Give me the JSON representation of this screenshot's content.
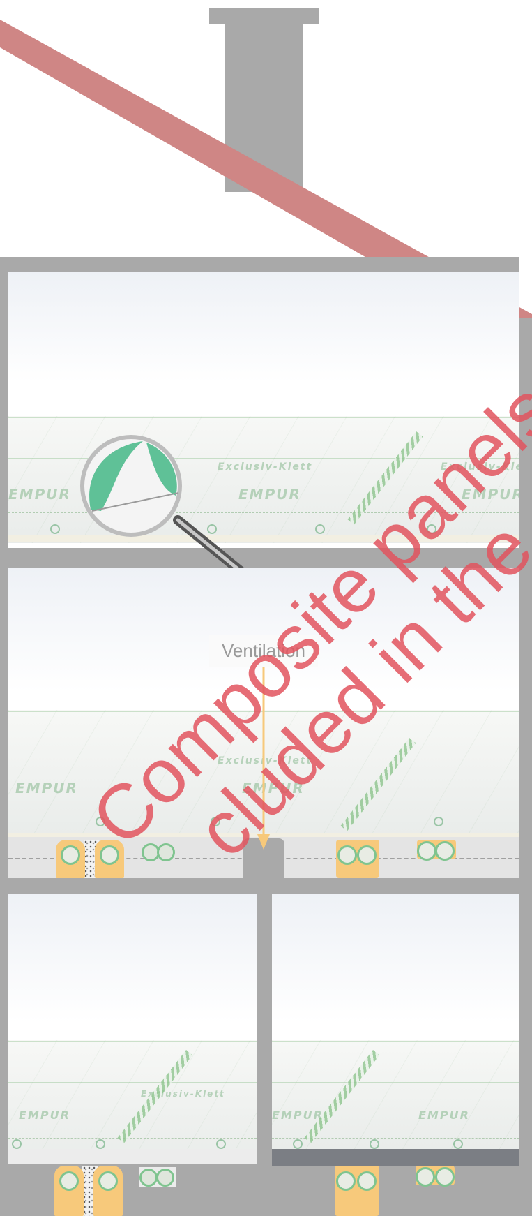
{
  "labels": {
    "ventilation": "Ventilation",
    "brand_text": "EMPUR",
    "panel_text": "Exclusiv-Klett",
    "watermark_line1": "Composite panels",
    "watermark_line2": "cluded in the"
  },
  "colors": {
    "roof": "#cf8685",
    "walls": "#a9a9a9",
    "pipe": "#f7c97b",
    "pipe_ring": "#7fc48f",
    "ventilation_arrow": "#f7c97b",
    "watermark": "#e2545e",
    "panel_accent": "#8dc48d"
  },
  "icons": {
    "magnifier": "magnifier-icon",
    "arrow": "arrow-down-icon"
  }
}
